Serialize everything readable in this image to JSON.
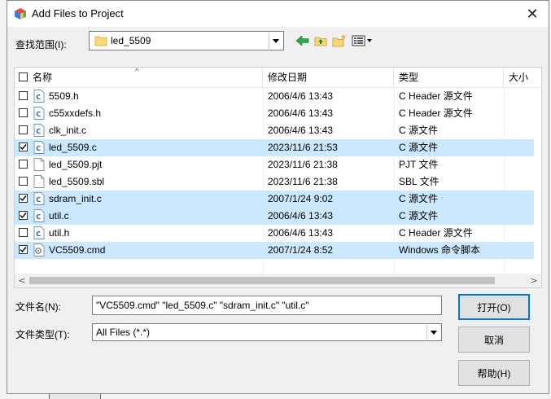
{
  "window": {
    "title": "Add Files to Project",
    "close_glyph": "✕"
  },
  "look_in": {
    "label": "查找范围(I):",
    "value": "led_5509"
  },
  "columns": {
    "name": "名称",
    "date": "修改日期",
    "type": "类型",
    "size": "大小"
  },
  "files": [
    {
      "name": "5509.h",
      "date": "2006/4/6 13:43",
      "type": "C Header 源文件",
      "checked": false,
      "icon": "c-file-icon"
    },
    {
      "name": "c55xxdefs.h",
      "date": "2006/4/6 13:43",
      "type": "C Header 源文件",
      "checked": false,
      "icon": "c-file-icon"
    },
    {
      "name": "clk_init.c",
      "date": "2006/4/6 13:43",
      "type": "C 源文件",
      "checked": false,
      "icon": "c-file-icon"
    },
    {
      "name": "led_5509.c",
      "date": "2023/11/6 21:53",
      "type": "C 源文件",
      "checked": true,
      "icon": "c-file-icon"
    },
    {
      "name": "led_5509.pjt",
      "date": "2023/11/6 21:38",
      "type": "PJT 文件",
      "checked": false,
      "icon": "blank-file-icon"
    },
    {
      "name": "led_5509.sbl",
      "date": "2023/11/6 21:38",
      "type": "SBL 文件",
      "checked": false,
      "icon": "blank-file-icon"
    },
    {
      "name": "sdram_init.c",
      "date": "2007/1/24 9:02",
      "type": "C 源文件",
      "checked": true,
      "icon": "c-file-icon"
    },
    {
      "name": "util.c",
      "date": "2006/4/6 13:43",
      "type": "C 源文件",
      "checked": true,
      "icon": "c-file-icon"
    },
    {
      "name": "util.h",
      "date": "2006/4/6 13:43",
      "type": "C Header 源文件",
      "checked": false,
      "icon": "c-file-icon"
    },
    {
      "name": "VC5509.cmd",
      "date": "2007/1/24 8:52",
      "type": "Windows 命令脚本",
      "checked": true,
      "icon": "cmd-file-icon"
    }
  ],
  "file_name": {
    "label": "文件名(N):",
    "value": "\"VC5509.cmd\" \"led_5509.c\" \"sdram_init.c\" \"util.c\""
  },
  "file_type": {
    "label": "文件类型(T):",
    "value": "All Files (*.*)"
  },
  "buttons": {
    "open": "打开(O)",
    "cancel": "取消",
    "help": "帮助(H)"
  },
  "colors": {
    "selection": "#cce8ff",
    "accent": "#0078d7",
    "folder": "#f8d775"
  }
}
